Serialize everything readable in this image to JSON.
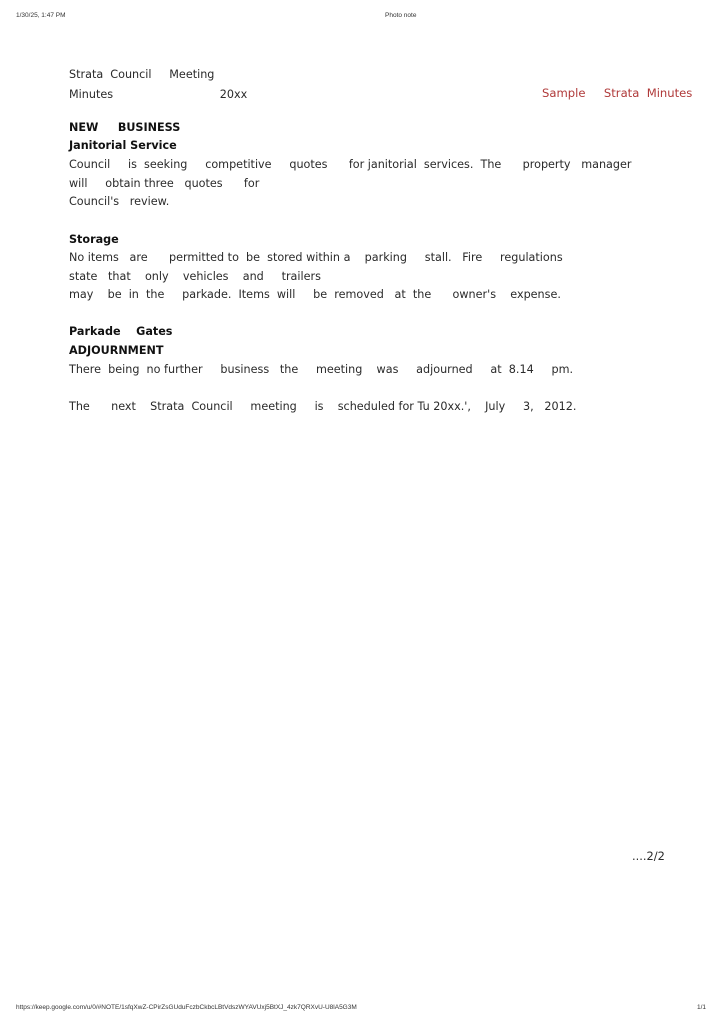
{
  "print_header": {
    "datetime": "1/30/25, 1:47 PM",
    "title": "Photo note"
  },
  "print_footer": {
    "url": "https://keep.google.com/u/0/#NOTE/1sfqXwZ-CPirZsGUduFczbCkbcLBtVdszWYAVUxj5BtXJ_4zk7QRXvU-U8lA5G3M",
    "page": "1/1"
  },
  "document": {
    "heading_line1": "Strata  Council     Meeting",
    "heading_line2": "Minutes                              20xx",
    "sample_title": "Sample     Strata  Minutes",
    "sections": {
      "new_business": "NEW     BUSINESS",
      "janitorial": {
        "title": "Janitorial Service",
        "lines": [
          "Council     is  seeking     competitive     quotes      for janitorial  services.  The      property   manager",
          "will     obtain three   quotes      for",
          "Council's   review."
        ]
      },
      "storage": {
        "title": "Storage",
        "lines": [
          "No items   are      permitted to  be  stored within a    parking     stall.   Fire     regulations",
          "state   that    only    vehicles    and     trailers",
          "may    be  in  the     parkade.  Items  will     be  removed   at  the      owner's    expense."
        ]
      },
      "parkade_gates": {
        "title": "Parkade    Gates"
      },
      "adjournment": {
        "title": "ADJOURNMENT",
        "lines": [
          "There  being  no further     business   the     meeting    was     adjourned     at  8.14     pm."
        ],
        "next_meeting": "The      next    Strata  Council     meeting     is    scheduled for Tu 20xx.',    July     3,   2012."
      }
    },
    "page_indicator": "....2/2"
  }
}
